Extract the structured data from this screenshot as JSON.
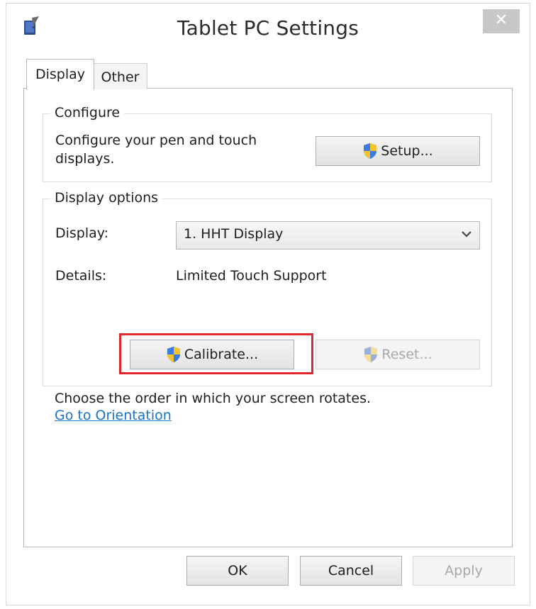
{
  "window": {
    "title": "Tablet PC Settings",
    "close_glyph": "✕"
  },
  "tabs": [
    {
      "label": "Display",
      "selected": true
    },
    {
      "label": "Other",
      "selected": false
    }
  ],
  "configure": {
    "legend": "Configure",
    "description_line1": "Configure your pen and touch",
    "description_line2": "displays.",
    "setup_label": "Setup..."
  },
  "display_options": {
    "legend": "Display options",
    "display_label": "Display:",
    "display_value": "1. HHT Display",
    "details_label": "Details:",
    "details_value": "Limited Touch Support",
    "calibrate_label": "Calibrate...",
    "reset_label": "Reset..."
  },
  "orientation": {
    "text": "Choose the order in which your screen rotates.",
    "link": "Go to Orientation"
  },
  "footer": {
    "ok": "OK",
    "cancel": "Cancel",
    "apply": "Apply"
  },
  "icons": {
    "app": "tablet-pen-icon",
    "uac_shield": "uac-shield-icon",
    "dropdown": "chevron-down-icon"
  },
  "colors": {
    "highlight": "#e2262c",
    "link": "#1a72c9",
    "close_button": "#c7c7c7"
  }
}
